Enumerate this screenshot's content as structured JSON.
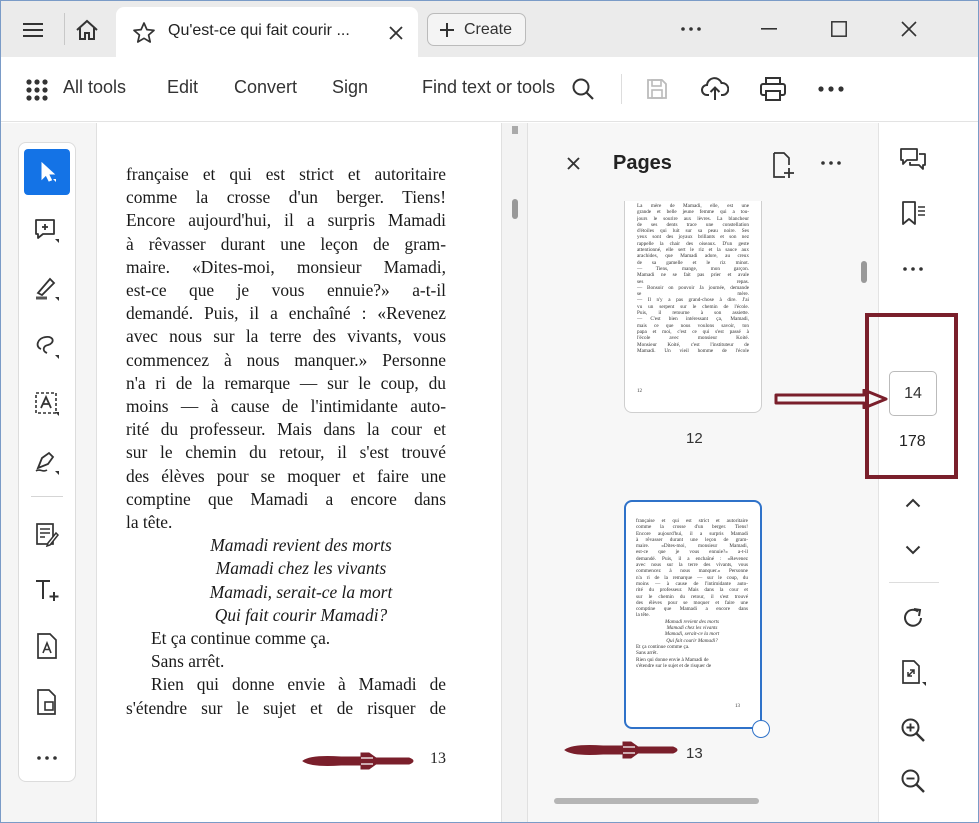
{
  "titlebar": {
    "tab_title": "Qu'est-ce qui fait courir ...",
    "create_label": "Create"
  },
  "toolbar": {
    "all_tools": "All tools",
    "edit": "Edit",
    "convert": "Convert",
    "sign": "Sign",
    "find": "Find text or tools"
  },
  "document": {
    "lines": [
      "française et qui est strict et autoritaire",
      "comme la crosse d'un berger. Tiens!",
      "Encore aujourd'hui, il a surpris Mamadi",
      "à rêvasser durant une leçon de gram-",
      "maire. «Dites-moi, monsieur Mamadi,",
      "est-ce que je vous ennuie?» a-t-il",
      "demandé. Puis, il a enchaîné : «Revenez",
      "avec nous sur la terre des vivants, vous",
      "commencez à nous manquer.» Personne",
      "n'a ri de la remarque — sur le coup, du",
      "moins — à cause de l'intimidante auto-",
      "rité du professeur. Mais dans la cour et",
      "sur le chemin du retour, il s'est trouvé",
      "des élèves pour se moquer et faire une",
      "comptine que Mamadi a encore dans",
      "la tête."
    ],
    "poem": [
      "Mamadi revient des morts",
      "Mamadi chez les vivants",
      "Mamadi, serait-ce la mort",
      "Qui fait courir Mamadi?"
    ],
    "after": [
      "Et ça continue comme ça.",
      "Sans arrêt.",
      "Rien qui donne envie à Mamadi de",
      "s'étendre sur le sujet et de risquer de"
    ],
    "page_number": "13"
  },
  "pages_panel": {
    "title": "Pages",
    "thumb1_label": "12",
    "thumb2_label": "13",
    "thumb1_lines": [
      "La mère de Mamadi, elle, est une",
      "grande et belle jeune femme qui a tou-",
      "jours le sourire aux lèvres. La blancheur",
      "de ses dents trace une constellation",
      "d'étoiles qui luit sur sa peau noire. Ses",
      "yeux sont des joyaux brillants et son nez",
      "rappelle la chair des oiseaux. D'un geste",
      "attentionné, elle sert le riz et la sauce aux",
      "arachides, que Mamadi adore, au creux",
      "de sa gamelle et le riz minot.",
      "— Tiens, mange, mon garçon.",
      "Mamadi ne se fait pas prier et avale",
      "ses repas.",
      "— Bonsoir on pouvoir Ja journée, demande",
      "se mère.",
      "— Il n'y a pas grand-chose à dire. J'ai",
      "vu un serpent sur le chemin de l'école.",
      "Puis, il retourne à son assiette.",
      "— C'est bien intéressant ça, Mamadi,",
      "mais ce que nous voulons savoir, ton",
      "papa et moi, c'est ce qui s'est passé à",
      "l'école avec monsieur Koité.",
      "Monsieur Koité, c'est l'instituteur de",
      "Mamadi. Un vieil homme de l'école"
    ],
    "thumb1_pagenum": "12",
    "thumb2_lines": [
      "française et qui est strict et autoritaire",
      "comme la crosse d'un berger. Tiens!",
      "Encore aujourd'hui, il a surpris Mamadi",
      "à rêvasser durant une leçon de gram-",
      "maire. «Dites-moi, monsieur Mamadi,",
      "est-ce que je vous ennuie?» a-t-il",
      "demandé. Puis, il a enchaîné : «Revenez",
      "avec nous sur la terre des vivants, vous",
      "commencez à nous manquer.» Personne",
      "n'a ri de la remarque — sur le coup, du",
      "moins — à cause de l'intimidante auto-",
      "rité du professeur. Mais dans la cour et",
      "sur le chemin du retour, il s'est trouvé",
      "des élèves pour se moquer et faire une",
      "comptine que Mamadi a encore dans",
      "la tête."
    ],
    "thumb2_poem": [
      "Mamadi revient des morts",
      "Mamadi chez les vivants",
      "Mamadi, serait-ce la mort",
      "Qui fait courir Mamadi?"
    ],
    "thumb2_after": [
      "Et ça continue comme ça.",
      "Sans arrêt.",
      "Rien qui donne envie à Mamadi de",
      "s'étendre sur le sujet et de risquer de"
    ],
    "thumb2_pagenum": "13"
  },
  "right_rail": {
    "current_page": "14",
    "total_pages": "178"
  },
  "colors": {
    "accent": "#1473e6",
    "annotation": "#7a1f2b",
    "thumb_selected": "#2f72c9"
  }
}
